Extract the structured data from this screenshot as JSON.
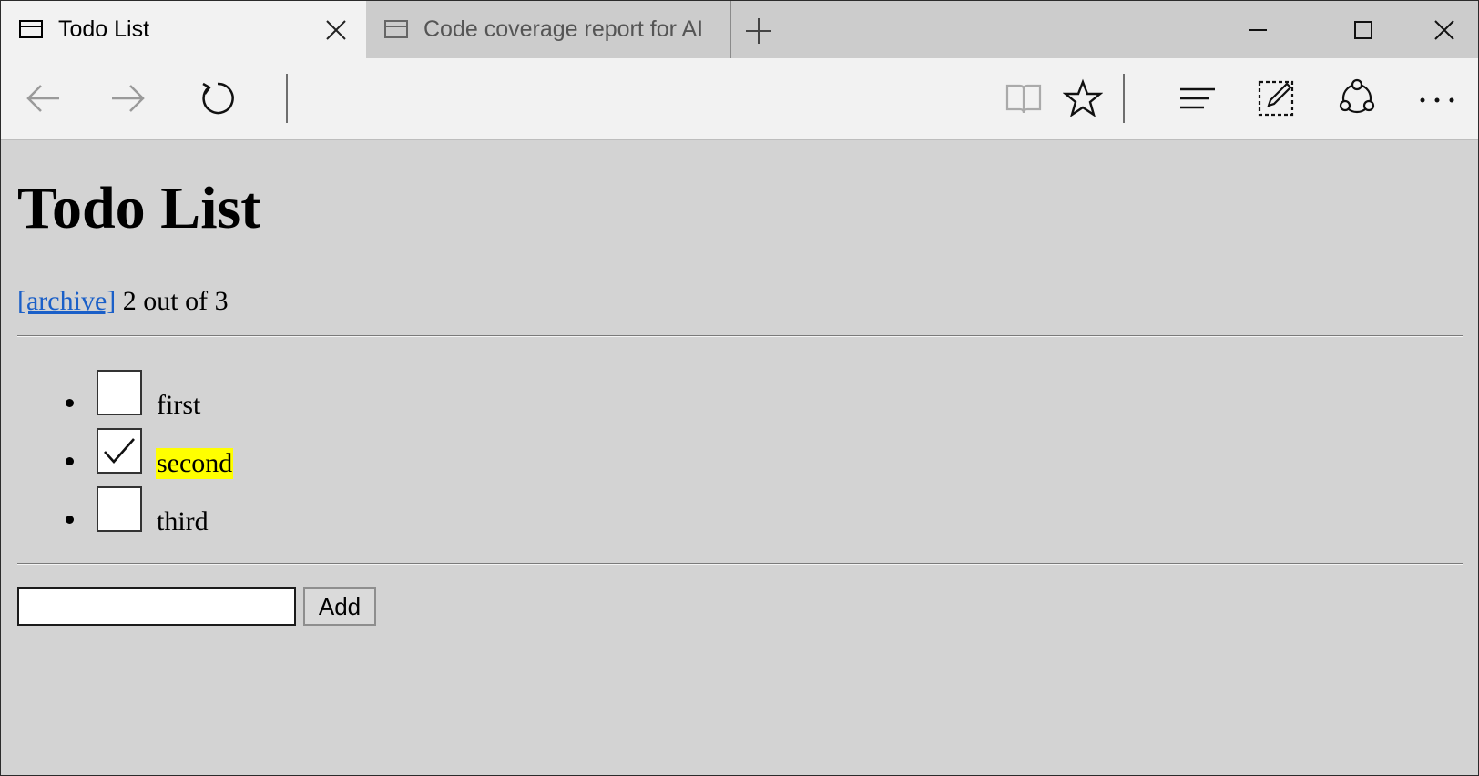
{
  "browser": {
    "tabs": [
      {
        "title": "Todo List",
        "active": true
      },
      {
        "title": "Code coverage report for AI",
        "active": false
      }
    ],
    "toolbar": {
      "buttons": [
        "back-icon",
        "forward-icon",
        "refresh-icon",
        "reading-view-icon",
        "favorite-star-icon",
        "hub-icon",
        "web-note-icon",
        "share-icon",
        "more-icon"
      ]
    },
    "window_controls": [
      "minimize-icon",
      "maximize-icon",
      "close-icon"
    ]
  },
  "page": {
    "title": "Todo List",
    "archive_label": "[archive]",
    "status": "2 out of 3",
    "todos": [
      {
        "text": "first",
        "done": false
      },
      {
        "text": "second",
        "done": true
      },
      {
        "text": "third",
        "done": false
      }
    ],
    "new_item_value": "",
    "add_label": "Add"
  },
  "colors": {
    "page_background": "#d3d3d3",
    "link": "#1a5fc8",
    "highlight": "#ffff00"
  }
}
